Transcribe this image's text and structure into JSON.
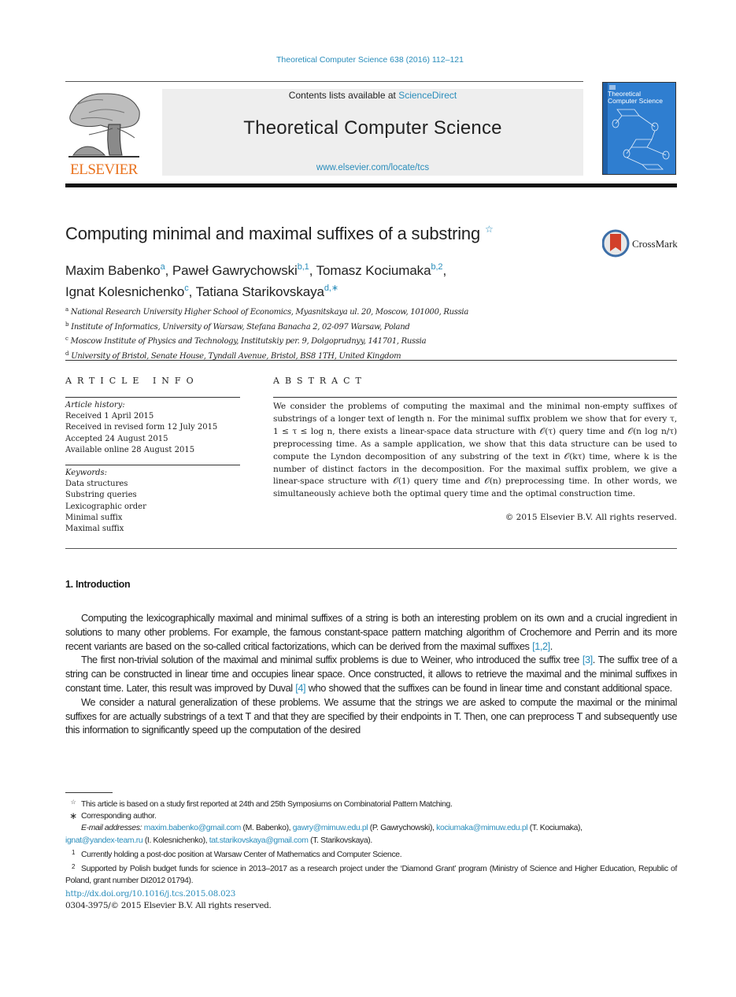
{
  "header": {
    "journal_ref": "Theoretical Computer Science 638 (2016) 112–121",
    "publisher_logo": "ELSEVIER",
    "contents_prefix": "Contents lists available at ",
    "contents_link": "ScienceDirect",
    "journal_title": "Theoretical Computer Science",
    "journal_url": "www.elsevier.com/locate/tcs",
    "cover_title_line1": "Theoretical",
    "cover_title_line2": "Computer Science"
  },
  "article": {
    "title": "Computing minimal and maximal suffixes of a substring",
    "title_note_mark": "☆",
    "crossmark_label": "CrossMark",
    "authors": [
      {
        "name": "Maxim Babenko",
        "sup": "a",
        "sep": ", "
      },
      {
        "name": "Paweł Gawrychowski",
        "sup": "b,1",
        "sep": ", "
      },
      {
        "name": "Tomasz Kociumaka",
        "sup": "b,2",
        "sep": ","
      },
      {
        "name": "Ignat Kolesnichenko",
        "sup": "c",
        "sep": ", "
      },
      {
        "name": "Tatiana Starikovskaya",
        "sup": "d,∗",
        "sep": ""
      }
    ],
    "affiliations": [
      {
        "mark": "a",
        "text": "National Research University Higher School of Economics, Myasnitskaya ul. 20, Moscow, 101000, Russia"
      },
      {
        "mark": "b",
        "text": "Institute of Informatics, University of Warsaw, Stefana Banacha 2, 02-097 Warsaw, Poland"
      },
      {
        "mark": "c",
        "text": "Moscow Institute of Physics and Technology, Institutskiy per. 9, Dolgoprudnyy, 141701, Russia"
      },
      {
        "mark": "d",
        "text": "University of Bristol, Senate House, Tyndall Avenue, Bristol, BS8 1TH, United Kingdom"
      }
    ]
  },
  "article_info": {
    "heading": "ARTICLE INFO",
    "history_label": "Article history:",
    "history": [
      "Received 1 April 2015",
      "Received in revised form 12 July 2015",
      "Accepted 24 August 2015",
      "Available online 28 August 2015"
    ],
    "keywords_label": "Keywords:",
    "keywords": [
      "Data structures",
      "Substring queries",
      "Lexicographic order",
      "Minimal suffix",
      "Maximal suffix"
    ]
  },
  "abstract": {
    "heading": "ABSTRACT",
    "text": "We consider the problems of computing the maximal and the minimal non-empty suffixes of substrings of a longer text of length n. For the minimal suffix problem we show that for every τ, 1 ≤ τ ≤ log n, there exists a linear-space data structure with 𝒪(τ) query time and 𝒪(n log n/τ) preprocessing time. As a sample application, we show that this data structure can be used to compute the Lyndon decomposition of any substring of the text in 𝒪(kτ) time, where k is the number of distinct factors in the decomposition. For the maximal suffix problem, we give a linear-space structure with 𝒪(1) query time and 𝒪(n) preprocessing time. In other words, we simultaneously achieve both the optimal query time and the optimal construction time.",
    "copyright": "© 2015 Elsevier B.V. All rights reserved."
  },
  "introduction": {
    "heading": "1. Introduction",
    "p1_a": "Computing the lexicographically maximal and minimal suffixes of a string is both an interesting problem on its own and a crucial ingredient in solutions to many other problems. For example, the famous constant-space pattern matching algorithm of Crochemore and Perrin and its more recent variants are based on the so-called critical factorizations, which can be derived from the maximal suffixes ",
    "p1_ref": "[1,2]",
    "p1_b": ".",
    "p2_a": "The first non-trivial solution of the maximal and minimal suffix problems is due to Weiner, who introduced the suffix tree ",
    "p2_ref1": "[3]",
    "p2_b": ". The suffix tree of a string can be constructed in linear time and occupies linear space. Once constructed, it allows to retrieve the maximal and the minimal suffixes in constant time. Later, this result was improved by Duval ",
    "p2_ref2": "[4]",
    "p2_c": " who showed that the suffixes can be found in linear time and constant additional space.",
    "p3": "We consider a natural generalization of these problems. We assume that the strings we are asked to compute the maximal or the minimal suffixes for are actually substrings of a text T and that they are specified by their endpoints in T. Then, one can preprocess T and subsequently use this information to significantly speed up the computation of the desired"
  },
  "footnotes": {
    "star_mark": "☆",
    "star_text": "This article is based on a study first reported at 24th and 25th Symposiums on Combinatorial Pattern Matching.",
    "corr_mark": "∗",
    "corr_text": "Corresponding author.",
    "email_label": "E-mail addresses:",
    "emails": [
      {
        "address": "maxim.babenko@gmail.com",
        "who": " (M. Babenko), "
      },
      {
        "address": "gawry@mimuw.edu.pl",
        "who": " (P. Gawrychowski), "
      },
      {
        "address": "kociumaka@mimuw.edu.pl",
        "who": " (T. Kociumaka), "
      },
      {
        "address": "ignat@yandex-team.ru",
        "who": " (I. Kolesnichenko), "
      },
      {
        "address": "tat.starikovskaya@gmail.com",
        "who": " (T. Starikovskaya)."
      }
    ],
    "fn1_mark": "1",
    "fn1_text": "Currently holding a post-doc position at Warsaw Center of Mathematics and Computer Science.",
    "fn2_mark": "2",
    "fn2_text": "Supported by Polish budget funds for science in 2013–2017 as a research project under the ‘Diamond Grant’ program (Ministry of Science and Higher Education, Republic of Poland, grant number DI2012 01794)."
  },
  "footer": {
    "doi": "http://dx.doi.org/10.1016/j.tcs.2015.08.023",
    "issn": "0304-3975/© 2015 Elsevier B.V. All rights reserved."
  },
  "colors": {
    "link": "#2a8dbb",
    "elsevier_orange": "#e9711c",
    "cover_blue": "#2f7ed0",
    "banner_gray": "#eeeeee"
  }
}
